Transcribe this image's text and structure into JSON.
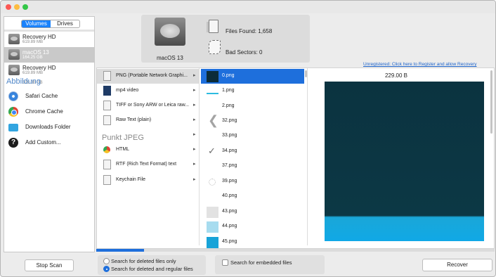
{
  "sidebar": {
    "tabs": [
      {
        "label": "Volumes",
        "selected": true
      },
      {
        "label": "Drives",
        "selected": false
      }
    ],
    "volumes": [
      {
        "name": "Recovery HD",
        "size": "619.89 MB",
        "selected": false
      },
      {
        "name": "macOS 13",
        "size": "164.25 GB",
        "selected": true
      },
      {
        "name": "Recovery HD",
        "size": "619.89 MB",
        "selected": false
      },
      {
        "name": "",
        "size": "309.00 GB",
        "selected": false
      }
    ],
    "overlay_label": "Abbildung",
    "caches": [
      {
        "label": "Safari Cache",
        "icon": "safari-icon"
      },
      {
        "label": "Chrome Cache",
        "icon": "chrome-icon"
      },
      {
        "label": "Downloads Folder",
        "icon": "folder-icon"
      },
      {
        "label": "Add Custom...",
        "icon": "help-icon"
      }
    ]
  },
  "summary": {
    "disk_name": "macOS 13",
    "files_found": "Files Found:  1,658",
    "bad_sectors": "Bad Sectors:  0"
  },
  "register_link": "Unregistered: Click here to Register and allow Recovery",
  "file_types": [
    {
      "label": "PNG (Portable Network Graphi...",
      "selected": true
    },
    {
      "label": "mp4 video",
      "selected": false
    },
    {
      "label": "TIFF or Sony ARW or Leica raw...",
      "selected": false
    },
    {
      "label": "Raw Text (plain)",
      "selected": false
    },
    {
      "label": "",
      "selected": false
    },
    {
      "label": "HTML",
      "selected": false
    },
    {
      "label": "RTF (Rich Text Format) text",
      "selected": false
    },
    {
      "label": "Keychain File",
      "selected": false
    }
  ],
  "overlay_punkt": "Punkt JPEG",
  "files": [
    {
      "name": "0.png",
      "selected": true
    },
    {
      "name": "1.png",
      "selected": false
    },
    {
      "name": "2.png",
      "selected": false
    },
    {
      "name": "32.png",
      "selected": false
    },
    {
      "name": "33.png",
      "selected": false
    },
    {
      "name": "34.png",
      "selected": false
    },
    {
      "name": "37.png",
      "selected": false
    },
    {
      "name": "39.png",
      "selected": false
    },
    {
      "name": "40.png",
      "selected": false
    },
    {
      "name": "43.png",
      "selected": false
    },
    {
      "name": "44.png",
      "selected": false
    },
    {
      "name": "45.png",
      "selected": false
    }
  ],
  "preview": {
    "size": "229.00 B"
  },
  "scan_progress": 0.12,
  "bottom": {
    "stop_label": "Stop Scan",
    "option_deleted_only": "Search for deleted files only",
    "option_deleted_regular": "Search for deleted and regular files",
    "embedded_label": "Search for embedded files",
    "recover_label": "Recover"
  },
  "colors": {
    "accent": "#1e6fdc",
    "preview_dark": "#0c3845",
    "preview_cyan": "#10a8e6"
  }
}
